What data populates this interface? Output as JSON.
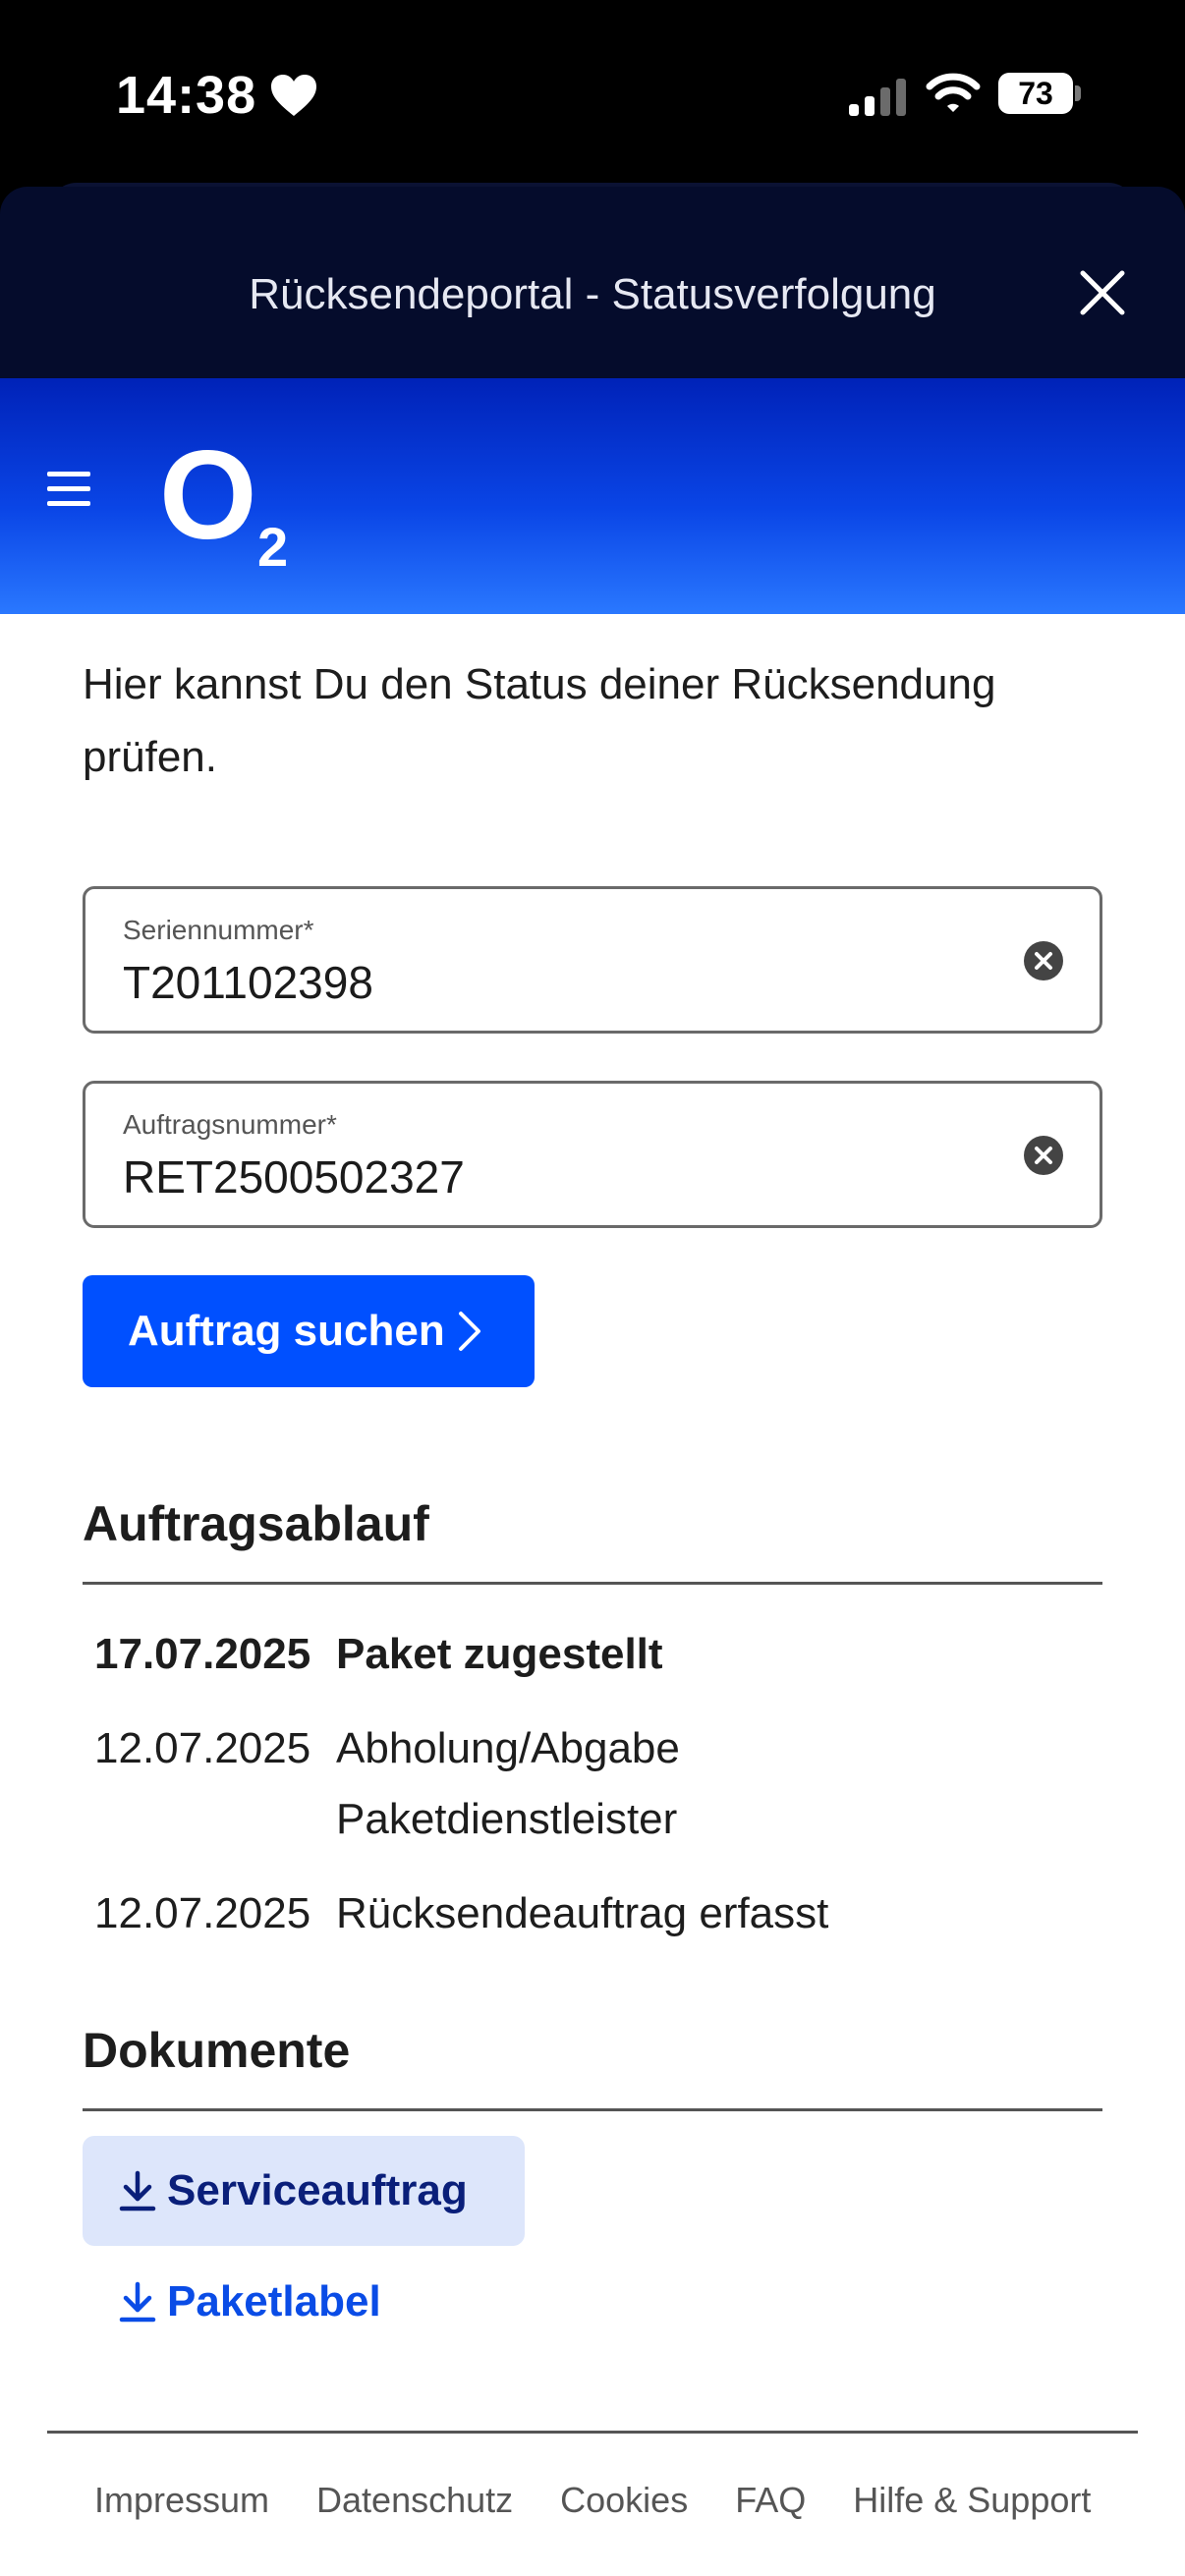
{
  "status_bar": {
    "time": "14:38",
    "battery": "73",
    "icons": [
      "heart-icon",
      "signal-icon",
      "wifi-icon",
      "battery-icon"
    ]
  },
  "sheet": {
    "title": "Rücksendeportal - Statusverfolgung"
  },
  "brand": {
    "logo_letter": "O",
    "logo_sub": "2",
    "colors": {
      "primary": "#0050ff",
      "dark": "#050c2c",
      "link": "#0a4ce6"
    }
  },
  "intro": "Hier kannst Du den Status deiner Rücksendung prüfen.",
  "form": {
    "serial_label": "Seriennummer*",
    "serial_value": "T201102398",
    "order_label": "Auftragsnummer*",
    "order_value": "RET2500502327",
    "search_label": "Auftrag suchen"
  },
  "timeline": {
    "title": "Auftragsablauf",
    "entries": [
      {
        "date": "17.07.2025",
        "event": "Paket zugestellt"
      },
      {
        "date": "12.07.2025",
        "event": "Abholung/Abgabe Paketdienstleister"
      },
      {
        "date": "12.07.2025",
        "event": "Rücksendeauftrag erfasst"
      }
    ]
  },
  "documents": {
    "title": "Dokumente",
    "items": [
      "Serviceauftrag",
      "Paketlabel"
    ]
  },
  "footer": {
    "links": [
      "Impressum",
      "Datenschutz",
      "Cookies",
      "FAQ",
      "Hilfe & Support"
    ]
  }
}
